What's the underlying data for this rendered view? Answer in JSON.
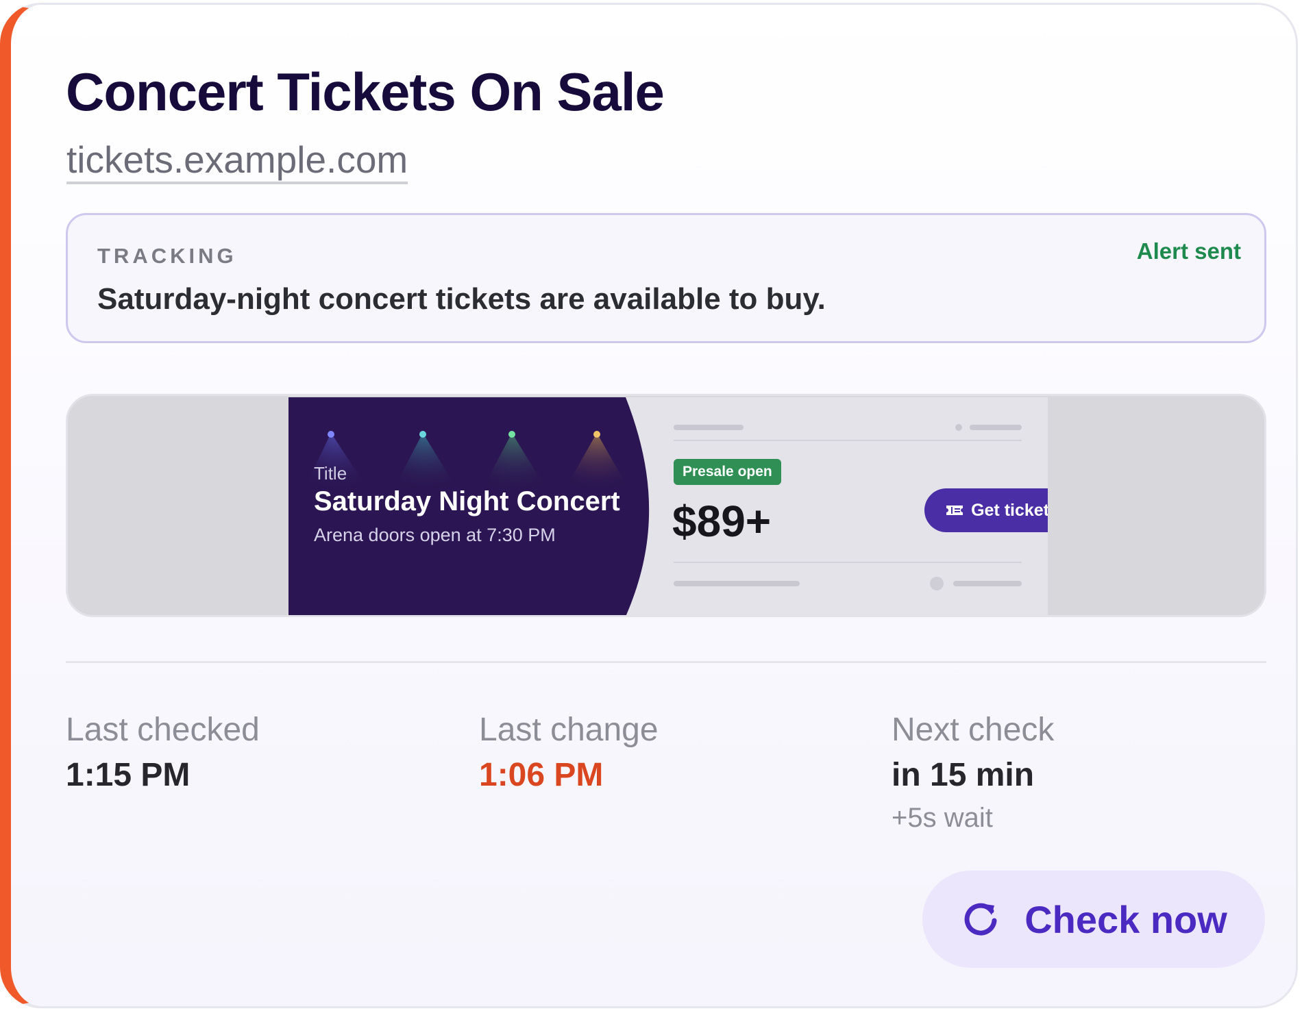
{
  "monitor": {
    "title": "Concert Tickets On Sale",
    "url": "tickets.example.com",
    "accent_color": "#f05a2a"
  },
  "tracking": {
    "label": "TRACKING",
    "condition": "Saturday-night concert tickets are available to buy.",
    "status": "Alert sent",
    "status_color": "#1f8a4e"
  },
  "preview": {
    "hero_label": "Title",
    "hero_title": "Saturday Night Concert",
    "hero_subtitle": "Arena doors open at 7:30 PM",
    "badge": "Presale open",
    "price": "$89+",
    "cta_label": "Get tickets",
    "cta_icon": "ticket-icon"
  },
  "stats": {
    "last_checked": {
      "label": "Last checked",
      "value": "1:15 PM"
    },
    "last_change": {
      "label": "Last change",
      "value": "1:06 PM",
      "color": "#d9461f"
    },
    "next_check": {
      "label": "Next check",
      "value": "in 15 min",
      "note": "+5s wait"
    }
  },
  "actions": {
    "check_now_label": "Check now",
    "check_now_icon": "refresh-icon"
  }
}
